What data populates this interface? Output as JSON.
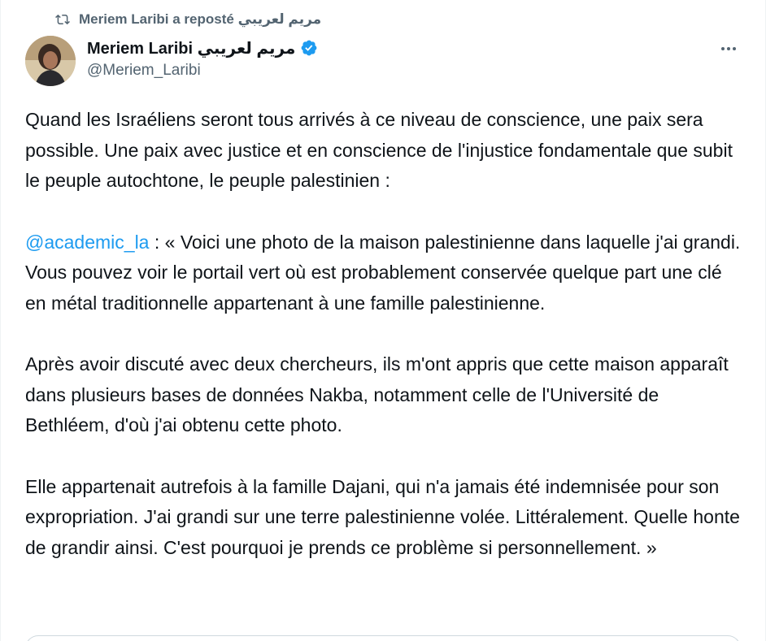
{
  "repost": {
    "icon": "repost-icon",
    "text": "مريم لعريبي Meriem Laribi a reposté"
  },
  "author": {
    "display_name": "Meriem Laribi مريم لعريبي",
    "handle": "@Meriem_Laribi",
    "verified_icon": "verified-badge-icon",
    "verified_color": "#1d9bf0"
  },
  "more_icon": "more-options-icon",
  "tweet": {
    "paragraph1": "Quand les Israéliens seront tous arrivés à ce niveau de conscience, une paix sera possible. Une paix avec justice et en conscience de l'injustice fondamentale que subit le peuple autochtone, le peuple palestinien :",
    "mention": "@academic_la",
    "paragraph2_rest": " : « Voici une photo de la maison palestinienne dans laquelle j'ai grandi. Vous pouvez voir le portail vert où est probablement conservée quelque part une clé en métal traditionnelle appartenant à une famille palestinienne.",
    "paragraph3": "Après avoir discuté avec deux chercheurs, ils m'ont appris que cette maison apparaît dans plusieurs bases de données Nakba, notamment celle de l'Université de Bethléem, d'où j'ai obtenu cette photo.",
    "paragraph4": "Elle appartenait autrefois à la famille Dajani, qui n'a jamais été indemnisée pour son expropriation.  J'ai grandi sur une terre palestinienne volée. Littéralement. Quelle honte de grandir ainsi. C'est pourquoi je prends ce problème si personnellement. »"
  },
  "colors": {
    "text": "#0f1419",
    "secondary": "#536471",
    "link": "#1d9bf0"
  }
}
